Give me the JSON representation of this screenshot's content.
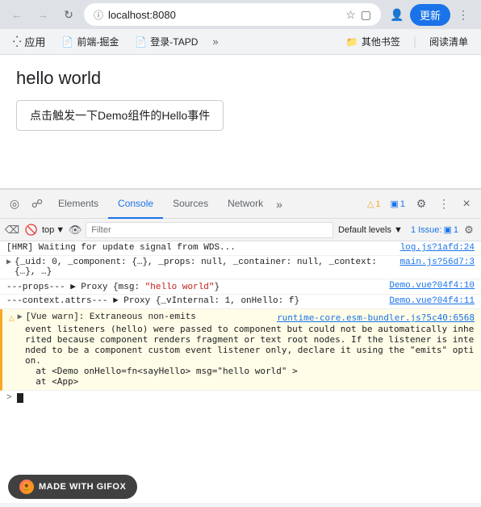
{
  "browser": {
    "url": "localhost:8080",
    "update_label": "更新",
    "back_tooltip": "back",
    "forward_tooltip": "forward",
    "reload_tooltip": "reload"
  },
  "bookmarks": {
    "apps_label": "应用",
    "items": [
      {
        "label": "前端-掘金",
        "icon": "bookmark"
      },
      {
        "label": "登录-TAPD",
        "icon": "bookmark"
      }
    ],
    "more_label": "»",
    "folder_label": "其他书签",
    "reading_label": "阅读清单"
  },
  "page": {
    "title": "hello world",
    "button_label": "点击触发一下Demo组件的Hello事件"
  },
  "devtools": {
    "tabs": [
      "Elements",
      "Console",
      "Sources",
      "Network"
    ],
    "active_tab": "Console",
    "more_label": "»",
    "warn_count": "1",
    "info_count": "1",
    "toolbar": {
      "top_label": "top",
      "filter_placeholder": "Filter",
      "default_levels_label": "Default levels",
      "issues_label": "1 Issue:",
      "issues_count": "1"
    },
    "console_lines": [
      {
        "type": "info",
        "text": "[HMR] Waiting for update signal from WDS...",
        "source": "log.js?1afd:24"
      },
      {
        "type": "expandable",
        "text": "{_uid: 0, _component: {…}, _props: null, _container: null, _context: {…}, …}",
        "source": "main.js?56d7:3"
      },
      {
        "type": "normal",
        "text": "---props--- ▶ Proxy {msg: \"hello world\"}",
        "source": "Demo.vue?04f4:10"
      },
      {
        "type": "normal",
        "text": "---context.attrs--- ▶ Proxy {_vInternal: 1, onHello: f}",
        "source": "Demo.vue?04f4:11"
      },
      {
        "type": "warning",
        "icon": "⚠",
        "text_parts": [
          "[Vue warn]: Extraneous non-emits event listeners (hello) were passed to component but could not be automatically inherited because component renders fragment or text root nodes. If the listener is intended to be a component custom event listener only, declare it using the \"emits\" option.",
          "  at <Demo onHello=fn<sayHello> msg=\"hello world\" >",
          "  at <App>"
        ],
        "source": "runtime-core.esm-bundler.js?5c40:6568"
      }
    ],
    "input_prompt": ">"
  },
  "gifox": {
    "label": "MADE WITH GIFOX"
  }
}
